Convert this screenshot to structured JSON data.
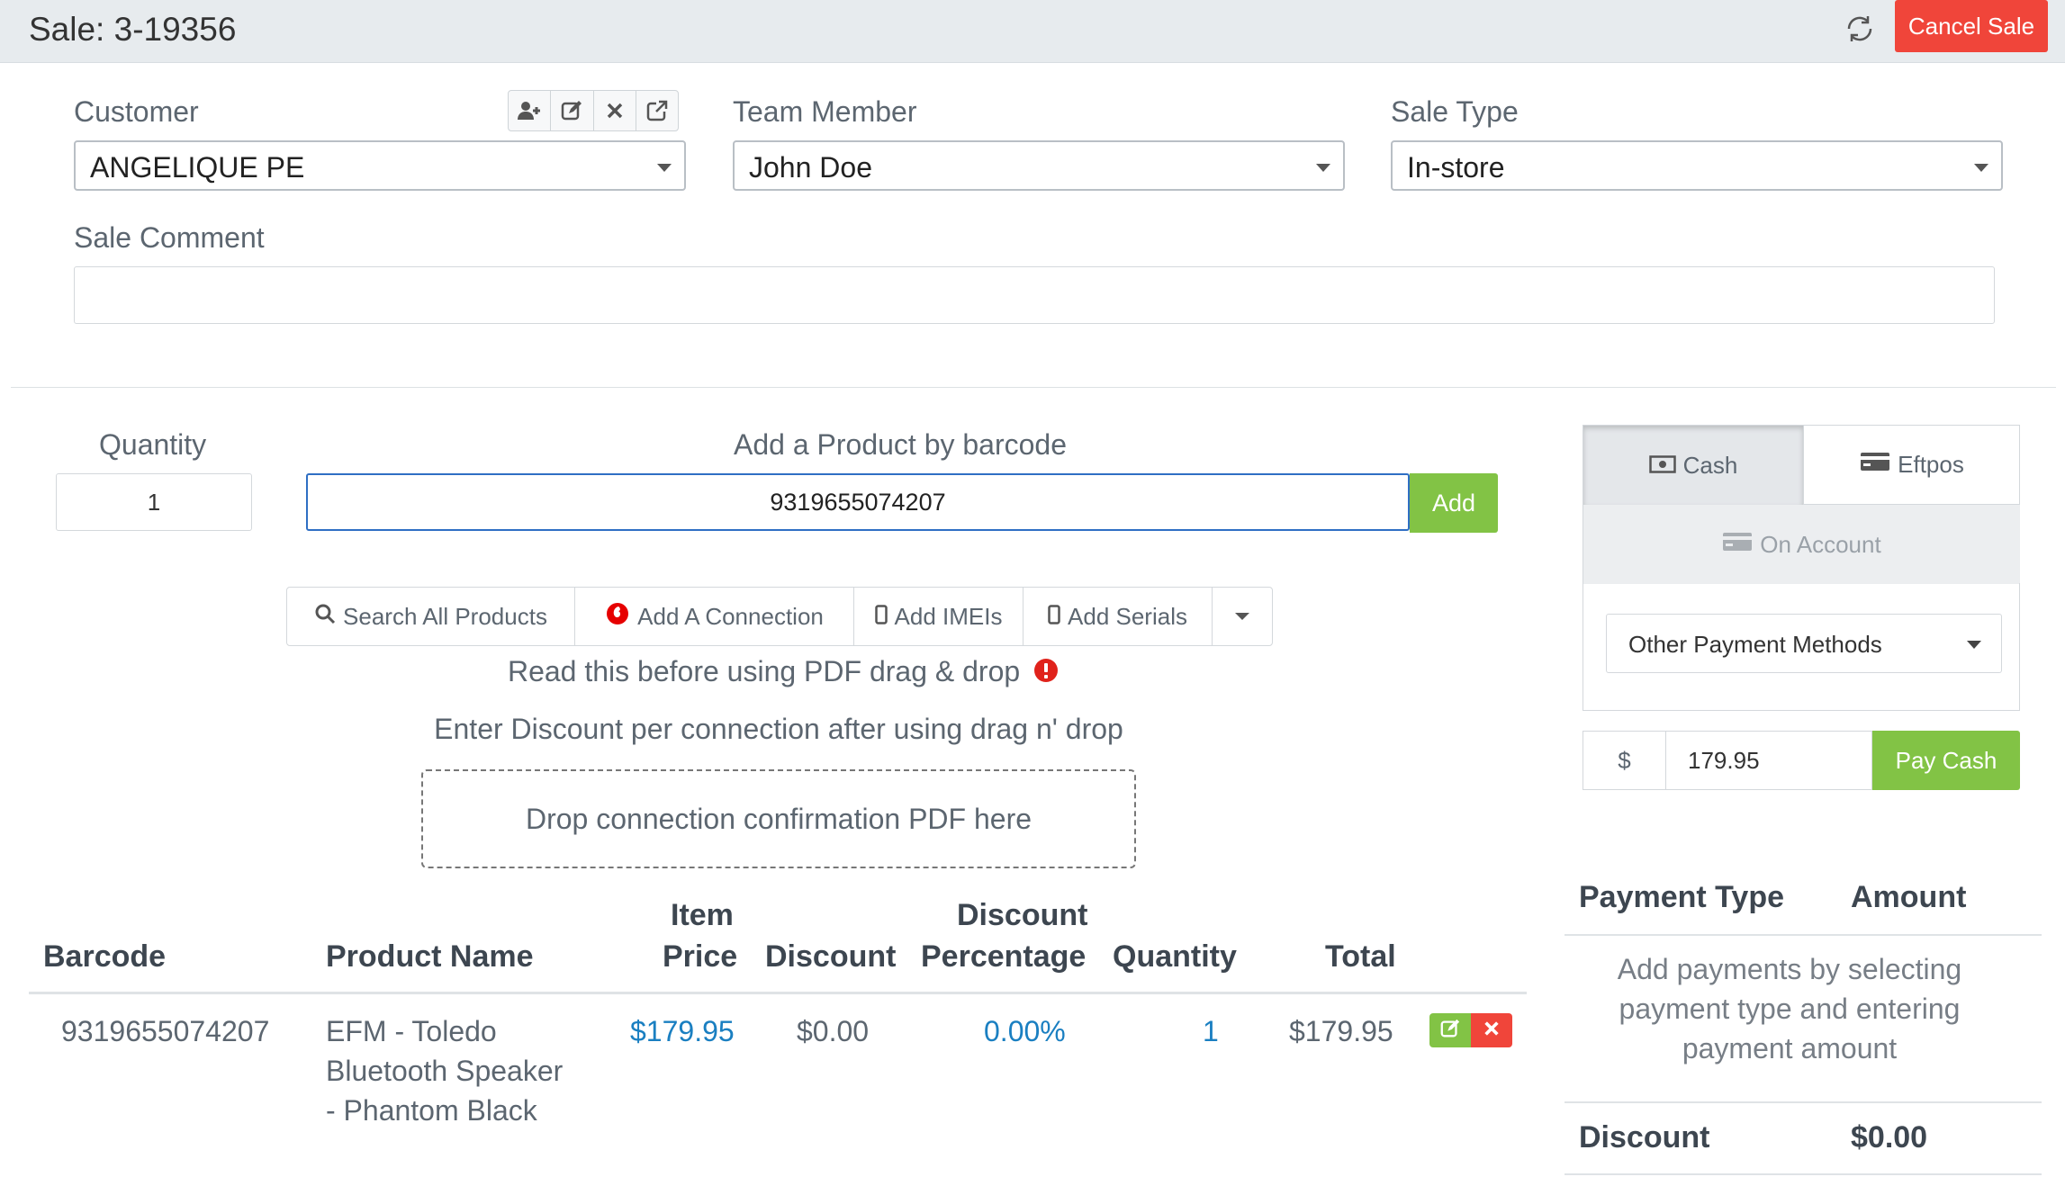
{
  "header": {
    "title": "Sale: 3-19356",
    "cancel_label": "Cancel Sale",
    "refresh_icon": "refresh-icon"
  },
  "form": {
    "customer_label": "Customer",
    "customer_value": "ANGELIQUE PE",
    "customer_tools": [
      "add-user-icon",
      "edit-icon",
      "close-icon",
      "external-link-icon"
    ],
    "team_member_label": "Team Member",
    "team_member_value": "John Doe",
    "sale_type_label": "Sale Type",
    "sale_type_value": "In-store",
    "sale_comment_label": "Sale Comment",
    "sale_comment_value": ""
  },
  "product_entry": {
    "quantity_label": "Quantity",
    "quantity_value": "1",
    "barcode_label": "Add a Product by barcode",
    "barcode_value": "9319655074207",
    "add_label": "Add",
    "buttons": {
      "search": "Search All Products",
      "connection": "Add A Connection",
      "imeis": "Add IMEIs",
      "serials": "Add Serials"
    },
    "pdf_notice": "Read this before using PDF drag & drop",
    "discount_notice": "Enter Discount per connection after using drag n' drop",
    "dropzone_label": "Drop connection confirmation PDF here"
  },
  "table": {
    "headers": {
      "barcode": "Barcode",
      "product_name": "Product Name",
      "item_price_1": "Item",
      "item_price_2": "Price",
      "discount": "Discount",
      "discount_pct_1": "Discount",
      "discount_pct_2": "Percentage",
      "quantity": "Quantity",
      "total": "Total"
    },
    "rows": [
      {
        "barcode": "9319655074207",
        "name_line1": "EFM - Toledo",
        "name_line2": "Bluetooth Speaker",
        "name_line3": "- Phantom Black",
        "item_price": "$179.95",
        "discount": "$0.00",
        "discount_pct": "0.00%",
        "quantity": "1",
        "total": "$179.95"
      }
    ]
  },
  "payment": {
    "tabs": {
      "cash": "Cash",
      "eftpos": "Eftpos",
      "on_account": "On Account"
    },
    "other_methods": "Other Payment Methods",
    "currency_symbol": "$",
    "amount": "179.95",
    "pay_label": "Pay Cash",
    "summary": {
      "type_header": "Payment Type",
      "amount_header": "Amount",
      "hint_line1": "Add payments by selecting",
      "hint_line2": "payment type and entering",
      "hint_line3": "payment amount",
      "discount_label": "Discount",
      "discount_value": "$0.00"
    }
  },
  "colors": {
    "accent_green": "#82c345",
    "danger_red": "#f0453a",
    "link_blue": "#1a7fc1",
    "focus_blue": "#2f6fc4"
  }
}
